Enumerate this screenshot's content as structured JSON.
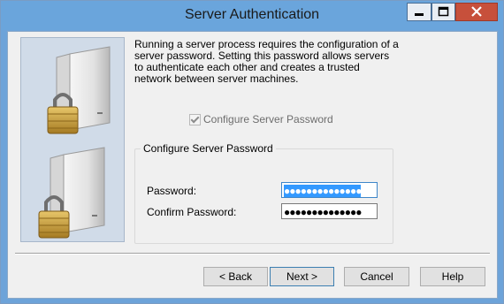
{
  "window": {
    "title": "Server Authentication"
  },
  "titlebar": {
    "icons": [
      "minimize-icon",
      "maximize-icon",
      "close-icon"
    ]
  },
  "body": {
    "description": "Running a server process requires the configuration of a server password. Setting this password allows servers to authenticate each other and creates a trusted network between server machines.",
    "configure_checkbox": {
      "label": "Configure Server Password",
      "checked": true,
      "enabled": false
    }
  },
  "group": {
    "legend": "Configure Server Password",
    "password_label": "Password:",
    "password_value": "●●●●●●●●●●●●●●",
    "confirm_label": "Confirm Password:",
    "confirm_value": "●●●●●●●●●●●●●●"
  },
  "buttons": {
    "back": "< Back",
    "next": "Next >",
    "cancel": "Cancel",
    "help": "Help"
  },
  "colors": {
    "titlebar": "#6aa5dc",
    "close": "#c7503b",
    "lock": "#c9a040",
    "selection": "#3399ff"
  }
}
